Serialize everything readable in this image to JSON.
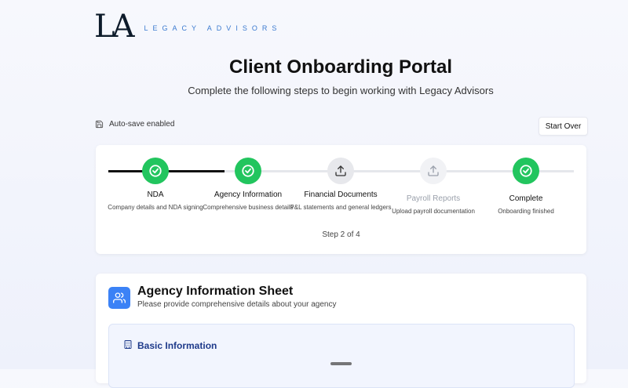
{
  "brand": {
    "mark": "LA",
    "name": "LEGACY ADVISORS"
  },
  "header": {
    "title": "Client Onboarding Portal",
    "subtitle": "Complete the following steps to begin working with Legacy Advisors"
  },
  "toolbar": {
    "autosave_label": "Auto-save enabled",
    "start_over_label": "Start Over"
  },
  "steps": [
    {
      "label": "NDA",
      "description": "Company details and NDA signing",
      "status": "done",
      "icon": "check-icon"
    },
    {
      "label": "Agency Information",
      "description": "Comprehensive business details",
      "status": "done",
      "icon": "check-icon"
    },
    {
      "label": "Financial Documents",
      "description": "P&L statements and general ledgers",
      "status": "current",
      "icon": "upload-icon"
    },
    {
      "label": "Payroll Reports",
      "description": "Upload payroll documentation",
      "status": "pending",
      "icon": "upload-icon"
    },
    {
      "label": "Complete",
      "description": "Onboarding finished",
      "status": "done",
      "icon": "check-icon"
    }
  ],
  "step_counter": "Step 2 of 4",
  "sheet": {
    "icon": "users-icon",
    "title": "Agency Information Sheet",
    "subtitle": "Please provide comprehensive details about your agency",
    "section_icon": "building-icon",
    "section_title": "Basic Information"
  },
  "colors": {
    "done": "#22c55e",
    "accent": "#3b82f6",
    "brand_blue": "#3b7bd0",
    "track_active": "#111111",
    "track_inactive": "#e5e7eb"
  }
}
